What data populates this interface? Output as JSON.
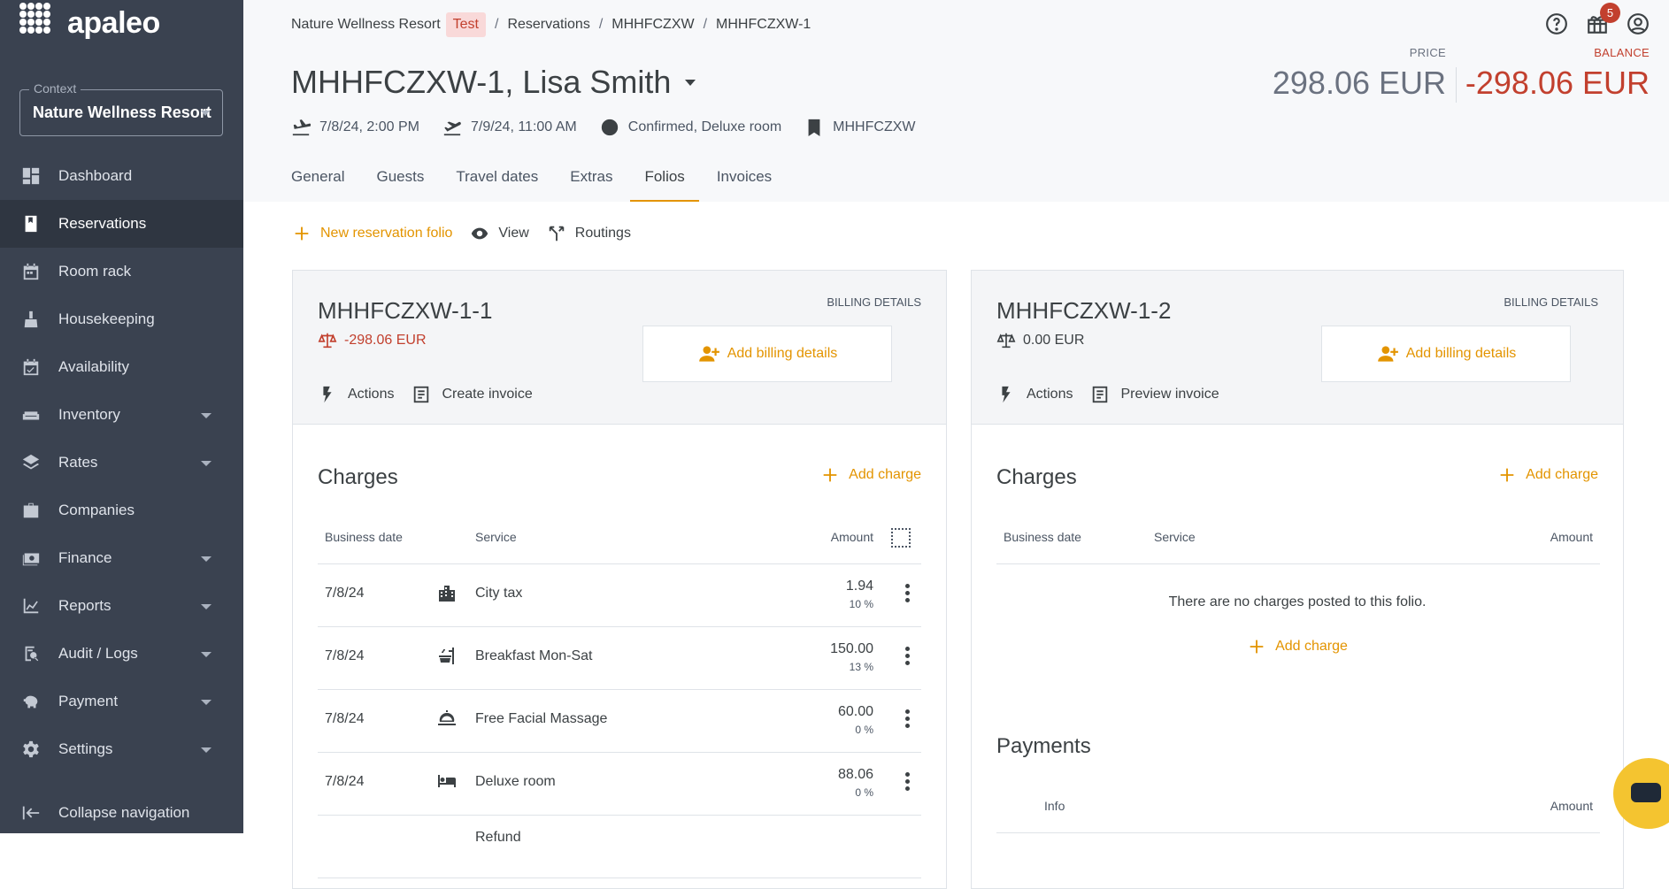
{
  "app": {
    "logo_text": "apaleo"
  },
  "context": {
    "label": "Context",
    "value": "Nature Wellness Resort"
  },
  "sidebar": {
    "items": [
      {
        "label": "Dashboard",
        "icon": "dashboard-icon",
        "active": false,
        "expandable": false
      },
      {
        "label": "Reservations",
        "icon": "book-icon",
        "active": true,
        "expandable": false
      },
      {
        "label": "Room rack",
        "icon": "calendar-icon",
        "active": false,
        "expandable": false
      },
      {
        "label": "Housekeeping",
        "icon": "broom-icon",
        "active": false,
        "expandable": false
      },
      {
        "label": "Availability",
        "icon": "calendar-check-icon",
        "active": false,
        "expandable": false
      },
      {
        "label": "Inventory",
        "icon": "sofa-icon",
        "active": false,
        "expandable": true
      },
      {
        "label": "Rates",
        "icon": "layers-icon",
        "active": false,
        "expandable": true
      },
      {
        "label": "Companies",
        "icon": "briefcase-icon",
        "active": false,
        "expandable": false
      },
      {
        "label": "Finance",
        "icon": "money-icon",
        "active": false,
        "expandable": true
      },
      {
        "label": "Reports",
        "icon": "chart-icon",
        "active": false,
        "expandable": true
      },
      {
        "label": "Audit / Logs",
        "icon": "audit-icon",
        "active": false,
        "expandable": true
      },
      {
        "label": "Payment",
        "icon": "piggy-bank-icon",
        "active": false,
        "expandable": true
      },
      {
        "label": "Settings",
        "icon": "gear-icon",
        "active": false,
        "expandable": true
      }
    ],
    "collapse_label": "Collapse navigation"
  },
  "header": {
    "breadcrumb": {
      "property": "Nature Wellness Resort",
      "env": "Test",
      "section": "Reservations",
      "booking": "MHHFCZXW",
      "reservation": "MHHFCZXW-1"
    },
    "notification_count": "5",
    "title": "MHHFCZXW-1, Lisa Smith",
    "arrival": "7/8/24, 2:00 PM",
    "departure": "7/9/24, 11:00 AM",
    "status": "Confirmed, Deluxe room",
    "booking_ref": "MHHFCZXW",
    "price_label": "PRICE",
    "price_value": "298.06 EUR",
    "balance_label": "BALANCE",
    "balance_value": "-298.06 EUR"
  },
  "tabs": [
    {
      "label": "General",
      "active": false
    },
    {
      "label": "Guests",
      "active": false
    },
    {
      "label": "Travel dates",
      "active": false
    },
    {
      "label": "Extras",
      "active": false
    },
    {
      "label": "Folios",
      "active": true
    },
    {
      "label": "Invoices",
      "active": false
    }
  ],
  "toolbar": {
    "new_folio": "New reservation folio",
    "view": "View",
    "routings": "Routings"
  },
  "folios": [
    {
      "id": "MHHFCZXW-1-1",
      "balance": "-298.06 EUR",
      "billing_label": "BILLING DETAILS",
      "add_billing": "Add billing details",
      "actions": "Actions",
      "invoice_action": "Create invoice",
      "charges_title": "Charges",
      "add_charge": "Add charge",
      "columns": {
        "date": "Business date",
        "service": "Service",
        "amount": "Amount"
      },
      "charges": [
        {
          "date": "7/8/24",
          "icon": "city-icon",
          "service": "City tax",
          "amount": "1.94",
          "vat": "10 %"
        },
        {
          "date": "7/8/24",
          "icon": "breakfast-icon",
          "service": "Breakfast Mon-Sat",
          "amount": "150.00",
          "vat": "13 %"
        },
        {
          "date": "7/8/24",
          "icon": "service-bell-icon",
          "service": "Free Facial Massage",
          "amount": "60.00",
          "vat": "0 %"
        },
        {
          "date": "7/8/24",
          "icon": "bed-icon",
          "service": "Deluxe room",
          "amount": "88.06",
          "vat": "0 %"
        },
        {
          "date": "",
          "icon": "refund-icon",
          "service": "Refund",
          "amount": "",
          "vat": ""
        }
      ]
    },
    {
      "id": "MHHFCZXW-1-2",
      "balance": "0.00 EUR",
      "billing_label": "BILLING DETAILS",
      "add_billing": "Add billing details",
      "actions": "Actions",
      "invoice_action": "Preview invoice",
      "charges_title": "Charges",
      "add_charge": "Add charge",
      "columns": {
        "date": "Business date",
        "service": "Service",
        "amount": "Amount"
      },
      "empty_text": "There are no charges posted to this folio.",
      "payments_title": "Payments",
      "payment_columns": {
        "info": "Info",
        "amount": "Amount"
      }
    }
  ],
  "colors": {
    "sidebar_bg": "#3a4250",
    "accent": "#e39400",
    "negative": "#c2402e"
  }
}
